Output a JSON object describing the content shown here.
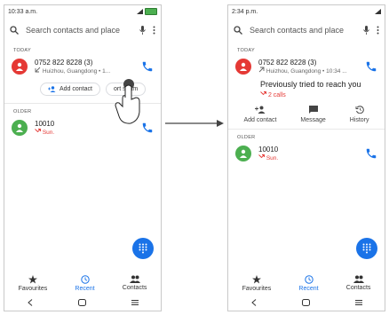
{
  "left": {
    "status": {
      "time": "10:33 a.m."
    },
    "search": {
      "placeholder": "Search contacts and place"
    },
    "today_label": "TODAY",
    "call1": {
      "number": "0752 822 8228 (3)",
      "detail": "Huizhou, Guangdong • 1..."
    },
    "chips": {
      "add_contact": "Add contact",
      "report": "ort spam"
    },
    "older_label": "OLDER",
    "call2": {
      "number": "10010",
      "detail": "Sun."
    },
    "nav": {
      "favourites": "Favourites",
      "recent": "Recent",
      "contacts": "Contacts"
    }
  },
  "right": {
    "status": {
      "time": "2:34 p.m."
    },
    "search": {
      "placeholder": "Search contacts and place"
    },
    "today_label": "TODAY",
    "call1": {
      "number": "0752 822 8228 (3)",
      "detail": "Huizhou, Guangdong • 10:34 ..."
    },
    "tried": {
      "title": "Previously tried to reach you",
      "calls": "2 calls"
    },
    "actions": {
      "add_contact": "Add contact",
      "message": "Message",
      "history": "History"
    },
    "older_label": "OLDER",
    "call2": {
      "number": "10010",
      "detail": "Sun."
    },
    "nav": {
      "favourites": "Favourites",
      "recent": "Recent",
      "contacts": "Contacts"
    }
  },
  "colors": {
    "accent": "#1a73e8",
    "missed": "#e53935",
    "avatar_green": "#4caf50"
  }
}
